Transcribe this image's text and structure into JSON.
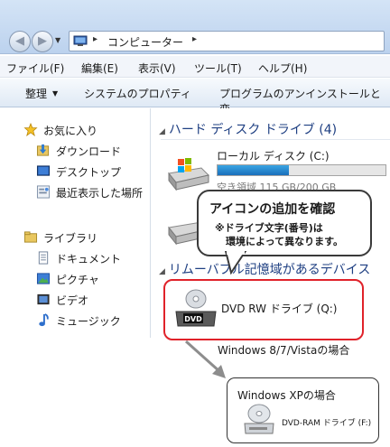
{
  "address": {
    "path": "コンピューター"
  },
  "menu": [
    "ファイル(F)",
    "編集(E)",
    "表示(V)",
    "ツール(T)",
    "ヘルプ(H)"
  ],
  "toolbar": {
    "organize": "整理",
    "system_properties": "システムのプロパティ",
    "uninstall": "プログラムのアンインストールと変"
  },
  "sidebar": {
    "favorites": "お気に入り",
    "downloads": "ダウンロード",
    "desktop": "デスクトップ",
    "recent": "最近表示した場所",
    "libraries": "ライブラリ",
    "documents": "ドキュメント",
    "pictures": "ピクチャ",
    "videos": "ビデオ",
    "music": "ミュージック"
  },
  "main": {
    "hdd_group": "ハード ディスク ドライブ (4)",
    "local_disk": "ローカル ディスク (C:)",
    "local_free": "空き領域 115 GB/200 GB",
    "used_fraction": 0.425,
    "removable_group": "リムーバブル記憶域があるデバイス",
    "dvd_drive": "DVD RW ドライブ (Q:)",
    "dvd_badge": "DVD"
  },
  "callout": {
    "title": "アイコンの追加を確認",
    "note_line1": "※ドライブ文字(番号)は",
    "note_line2": "環境によって異なります。"
  },
  "caption": "Windows 8/7/Vistaの場合",
  "xp": {
    "title": "Windows XPの場合",
    "label": "DVD-RAM ドライブ (F:)"
  },
  "colors": {
    "highlight": "#e0222a",
    "group_title": "#1e3f82",
    "bar": "#1a6fbb"
  }
}
